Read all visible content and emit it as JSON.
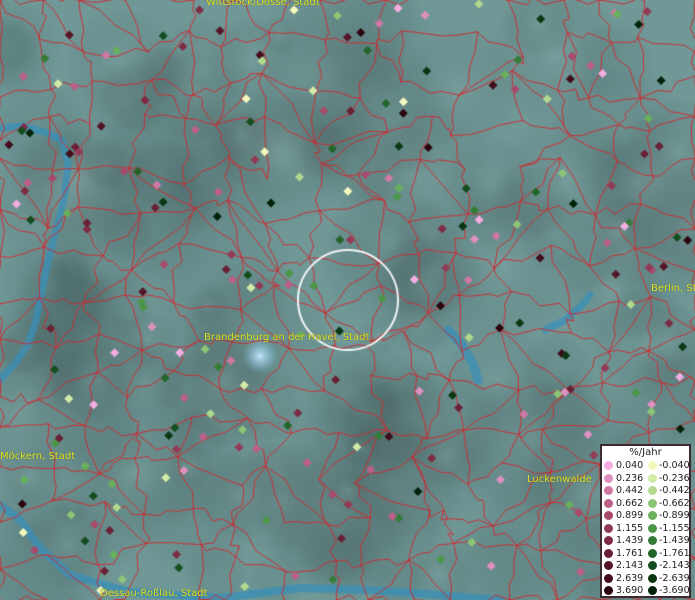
{
  "map": {
    "cities": [
      {
        "name": "Wittstock/Dosse, Stadt"
      },
      {
        "name": "Brandenburg an der Havel, Stadt"
      },
      {
        "name": "Berlin, Stadt"
      },
      {
        "name": "Möckern, Stadt"
      },
      {
        "name": "Luckenwalde"
      },
      {
        "name": "Dessau-Roßlau, Stadt"
      }
    ]
  },
  "legend": {
    "title": "%/Jahr",
    "positive": [
      {
        "label": "0.040",
        "color": "#f2aee0"
      },
      {
        "label": "0.236",
        "color": "#e090c0"
      },
      {
        "label": "0.442",
        "color": "#cf78a4"
      },
      {
        "label": "0.662",
        "color": "#bd5f88"
      },
      {
        "label": "0.899",
        "color": "#a84a6c"
      },
      {
        "label": "1.155",
        "color": "#933a56"
      },
      {
        "label": "1.439",
        "color": "#7e2c44"
      },
      {
        "label": "1.761",
        "color": "#6a2035"
      },
      {
        "label": "2.143",
        "color": "#551527"
      },
      {
        "label": "2.639",
        "color": "#420c1a"
      },
      {
        "label": "3.690",
        "color": "#2c040d"
      }
    ],
    "negative": [
      {
        "label": "-0.040",
        "color": "#f4f7bd"
      },
      {
        "label": "-0.236",
        "color": "#d5eba8"
      },
      {
        "label": "-0.442",
        "color": "#b2da8e"
      },
      {
        "label": "-0.662",
        "color": "#8dc676"
      },
      {
        "label": "-0.899",
        "color": "#69b05c"
      },
      {
        "label": "-1.155",
        "color": "#4b9647"
      },
      {
        "label": "-1.439",
        "color": "#357c37"
      },
      {
        "label": "-1.761",
        "color": "#23652a"
      },
      {
        "label": "-2.143",
        "color": "#144e1e"
      },
      {
        "label": "-2.639",
        "color": "#093812"
      },
      {
        "label": "-3.690",
        "color": "#02230a"
      }
    ]
  },
  "colors": {
    "background": "#6f9897",
    "boundary": "#d3262c",
    "water": "#3a8fb8",
    "label": "#e3e020"
  }
}
